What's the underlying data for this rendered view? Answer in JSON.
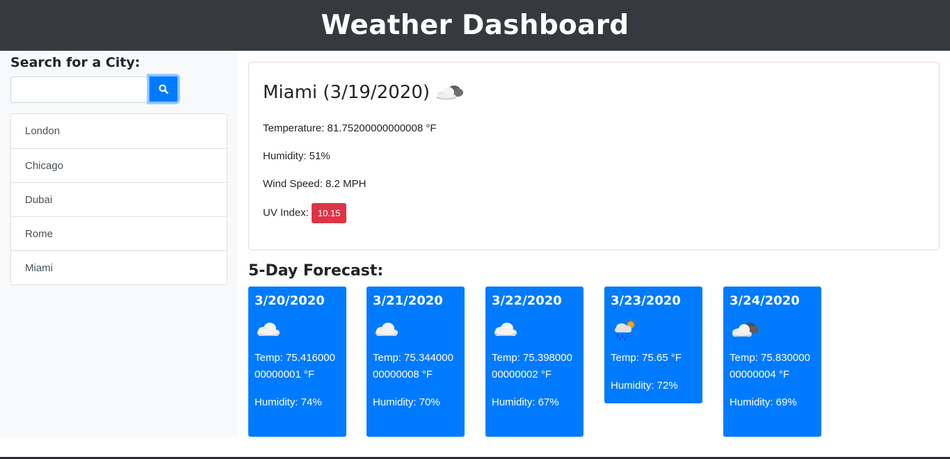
{
  "header": {
    "title": "Weather Dashboard"
  },
  "search": {
    "label": "Search for a City:",
    "value": "",
    "placeholder": "",
    "button_icon": "search-icon"
  },
  "history": [
    "London",
    "Chicago",
    "Dubai",
    "Rome",
    "Miami"
  ],
  "current": {
    "title": "Miami (3/19/2020)",
    "icon": "cloudy-icon",
    "temperature": "Temperature: 81.75200000000008 °F",
    "humidity": "Humidity: 51%",
    "wind": "Wind Speed: 8.2 MPH",
    "uv_label": "UV Index:",
    "uv_value": "10.15",
    "uv_color": "#dc3545"
  },
  "forecast": {
    "title": "5-Day Forecast:",
    "days": [
      {
        "date": "3/20/2020",
        "icon": "cloud-icon",
        "temp": "Temp: 75.41600000000001 °F",
        "humidity": "Humidity: 74%"
      },
      {
        "date": "3/21/2020",
        "icon": "cloud-icon",
        "temp": "Temp: 75.34400000000008 °F",
        "humidity": "Humidity: 70%"
      },
      {
        "date": "3/22/2020",
        "icon": "cloud-icon",
        "temp": "Temp: 75.39800000000002 °F",
        "humidity": "Humidity: 67%"
      },
      {
        "date": "3/23/2020",
        "icon": "rain-sun-icon",
        "temp": "Temp: 75.65 °F",
        "humidity": "Humidity: 72%"
      },
      {
        "date": "3/24/2020",
        "icon": "cloudy-icon",
        "temp": "Temp: 75.83000000000004 °F",
        "humidity": "Humidity: 69%"
      }
    ]
  },
  "colors": {
    "header_bg": "#343a40",
    "accent": "#007bff",
    "sidebar_bg": "#f8f9fa",
    "uv_danger": "#dc3545"
  }
}
